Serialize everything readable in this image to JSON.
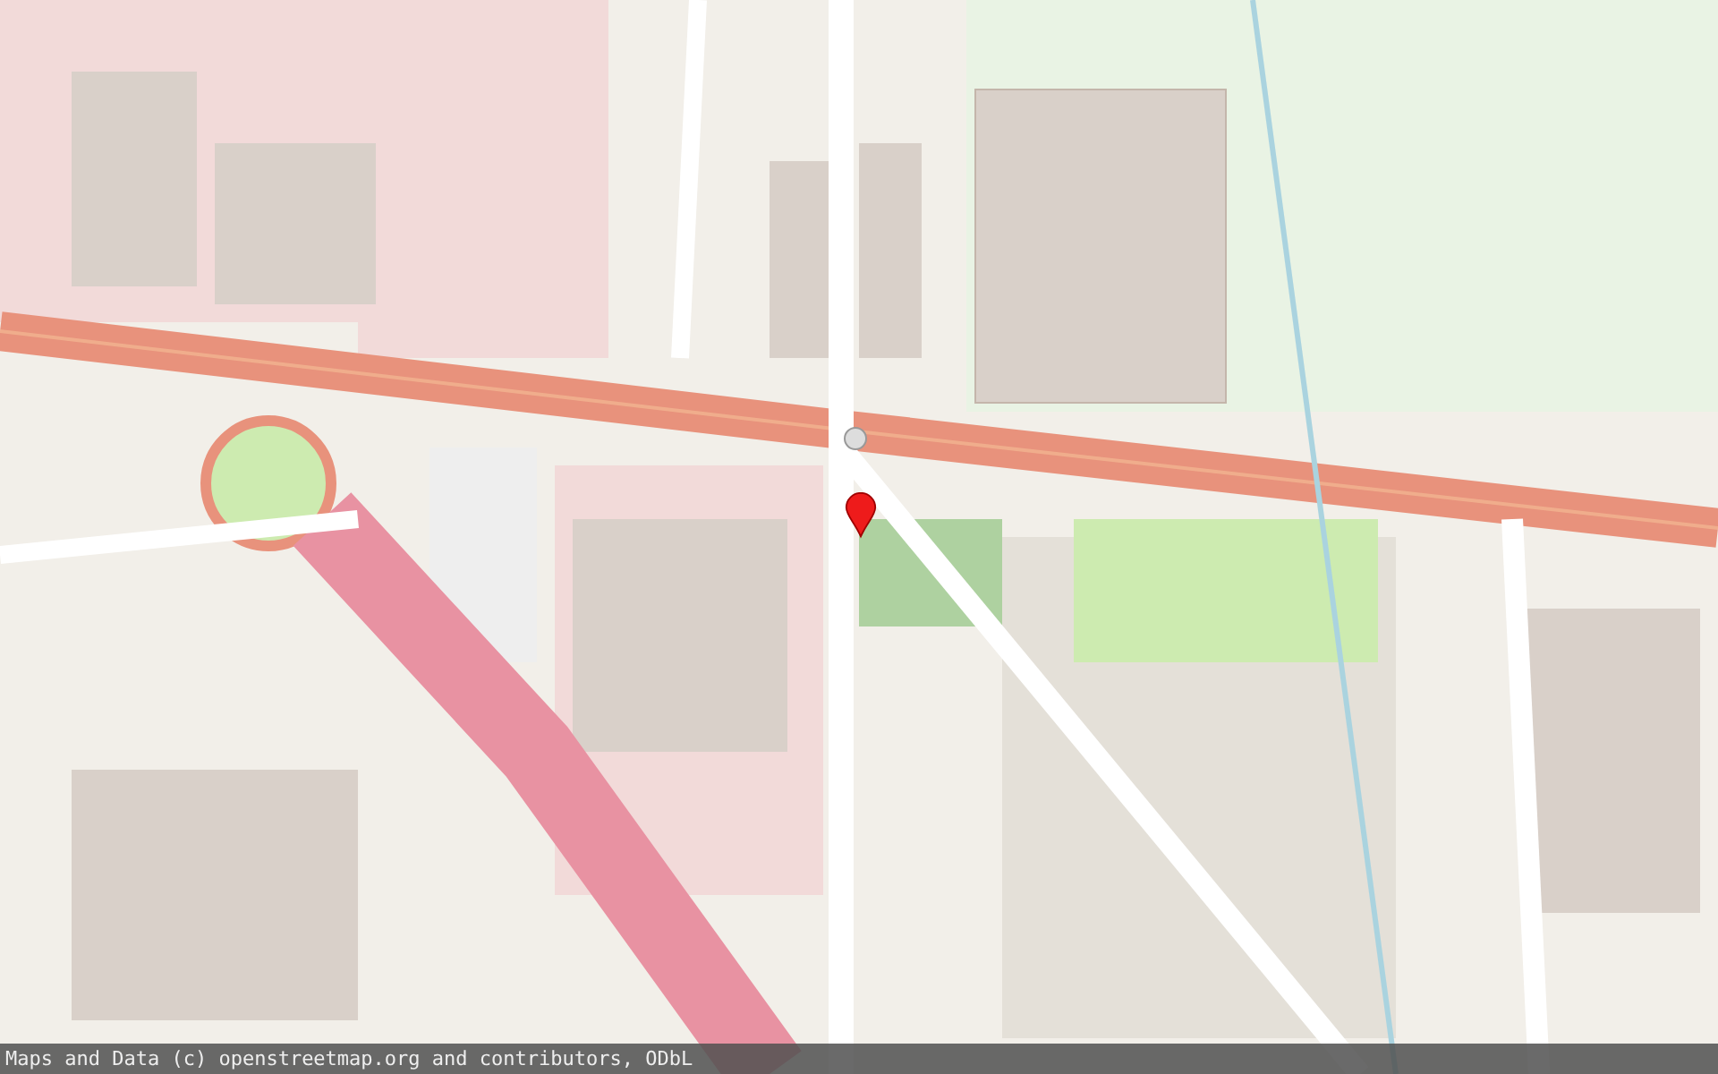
{
  "map": {
    "marker": {
      "kind": "pin"
    }
  },
  "attribution": {
    "text": "Maps and Data (c) openstreetmap.org and contributors, ODbL"
  }
}
